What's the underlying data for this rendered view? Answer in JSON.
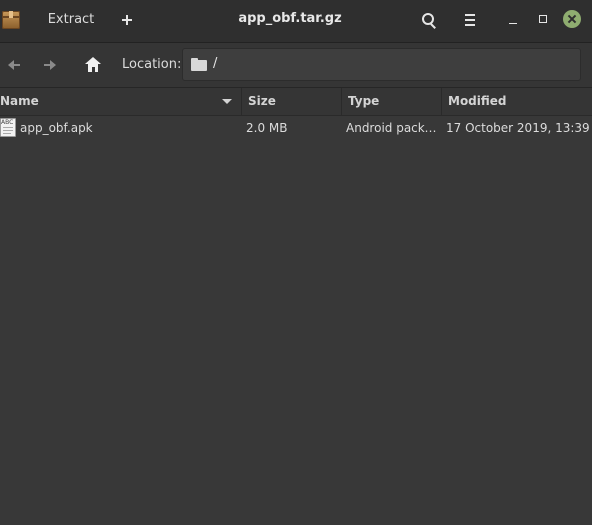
{
  "window": {
    "title": "app_obf.tar.gz"
  },
  "header": {
    "extract_label": "Extract"
  },
  "toolbar": {
    "location_label": "Location:",
    "location_path": "/"
  },
  "columns": {
    "name": "Name",
    "size": "Size",
    "type": "Type",
    "modified": "Modified"
  },
  "files": [
    {
      "name": "app_obf.apk",
      "size": "2.0 MB",
      "type": "Android packa...",
      "modified": "17 October 2019, 13:39",
      "icon": "text-file-icon"
    }
  ],
  "colors": {
    "close_button": "#8fad70",
    "background": "#383838",
    "headerbar": "#2f2f2f"
  }
}
